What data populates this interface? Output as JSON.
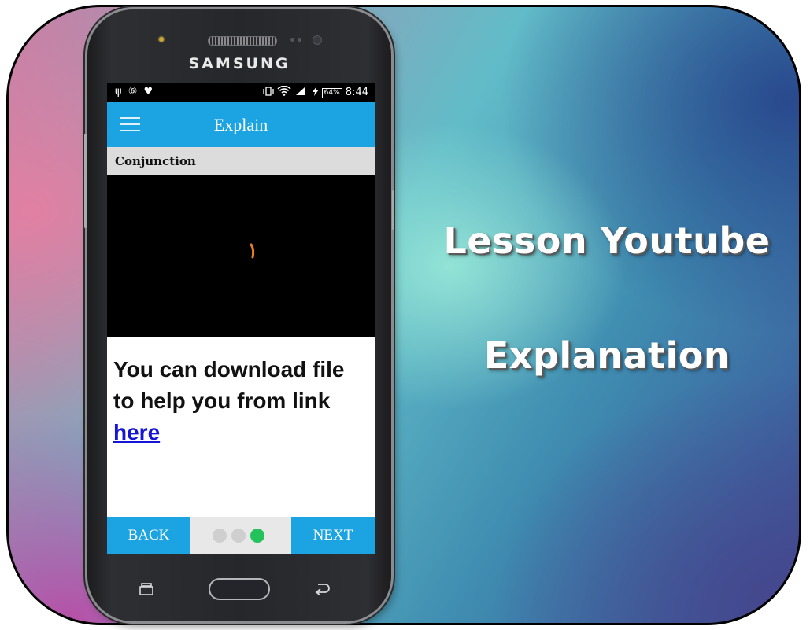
{
  "headline": {
    "line1": "Lesson Youtube",
    "line2": "Explanation"
  },
  "phone": {
    "brand": "SAMSUNG",
    "statusbar": {
      "left_icons": "ψ ⑥ ♥",
      "battery": "64%",
      "time": "8:44"
    },
    "appbar": {
      "title": "Explain",
      "menu_icon": "hamburger-icon"
    },
    "subheader": "Conjunction",
    "content": {
      "line1": "You can download file",
      "line2": "to help you from link",
      "link": "here"
    },
    "nav": {
      "back": "BACK",
      "next": "NEXT",
      "dots": [
        {
          "active": false,
          "color": "#cfcfcf"
        },
        {
          "active": false,
          "color": "#cfcfcf"
        },
        {
          "active": true,
          "color": "#23c25a"
        }
      ]
    }
  },
  "colors": {
    "accent": "#1ca4e2",
    "link": "#1515d6",
    "active_dot": "#23c25a"
  }
}
